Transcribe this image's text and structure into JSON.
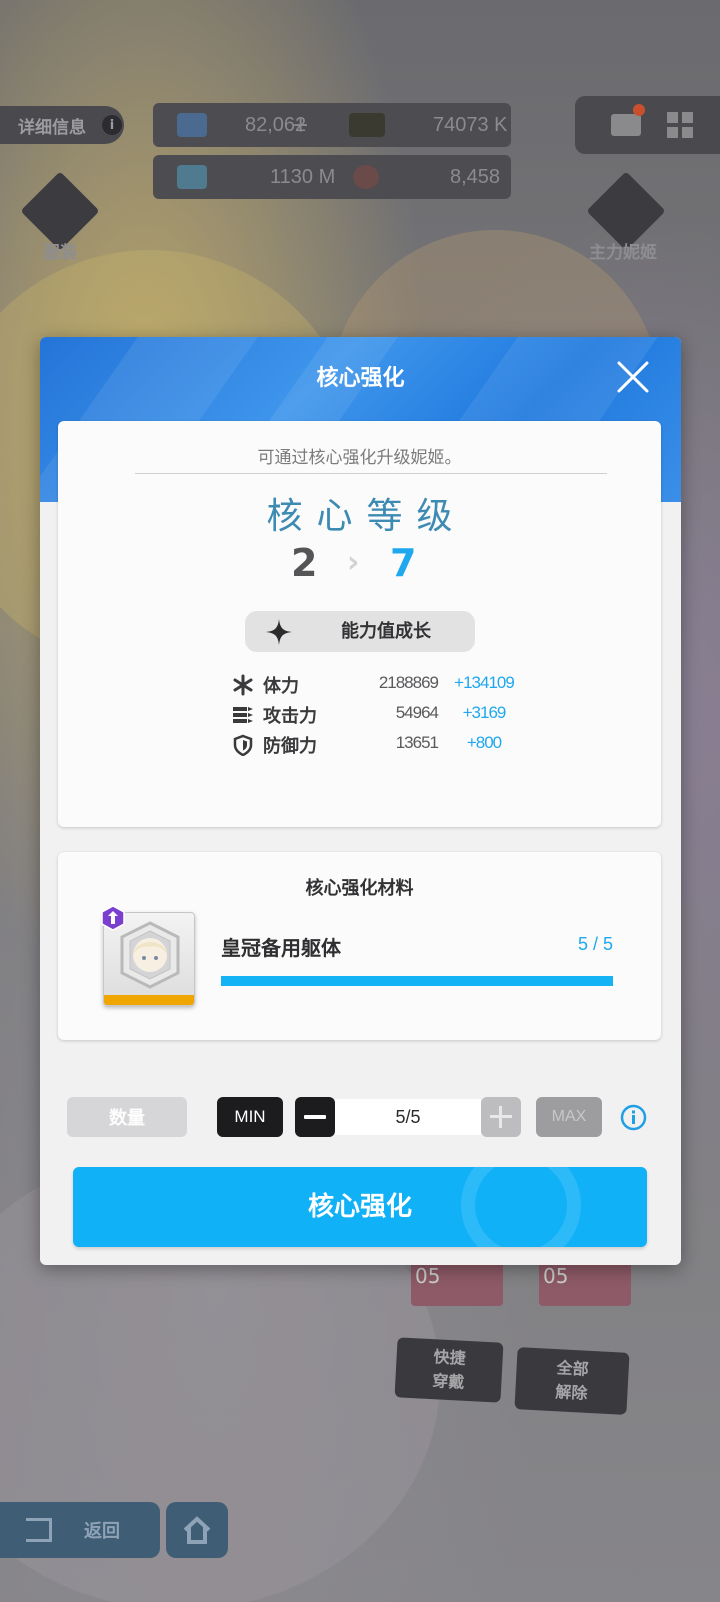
{
  "background": {
    "details_label": "详细信息",
    "resources": {
      "gems": "82,062",
      "credits": "74073 K",
      "battle_data": "1130 M",
      "core_dust": "8,458"
    },
    "outfit_label": "服装",
    "main_nikke_label": "主力妮姬",
    "quick_equip_label": "快捷\n穿戴",
    "remove_all_label": "全部\n解除",
    "back_label": "返回",
    "card_number_1": "05",
    "card_number_2": "05"
  },
  "modal": {
    "title": "核心强化",
    "hint": "可通过核心强化升级妮姬。",
    "level_title": "核心等级",
    "level_from": "2",
    "level_arrow": "›",
    "level_to": "7",
    "growth_label": "能力值成长",
    "stats": [
      {
        "name": "体力",
        "value": "2188869",
        "increase": "+134109",
        "icon": "asterisk-icon"
      },
      {
        "name": "攻击力",
        "value": "54964",
        "increase": "+3169",
        "icon": "bullets-icon"
      },
      {
        "name": "防御力",
        "value": "13651",
        "increase": "+800",
        "icon": "shield-icon"
      }
    ],
    "materials": {
      "title": "核心强化材料",
      "item_name": "皇冠备用躯体",
      "count": "5 / 5",
      "progress": 1.0
    },
    "quantity": {
      "label": "数量",
      "min_label": "MIN",
      "max_label": "MAX",
      "value": "5/5"
    },
    "action_label": "核心强化"
  },
  "colors": {
    "accent": "#20a8ee",
    "button": "#11b1f7",
    "header": "#2474d8",
    "progress": "#14b3f6",
    "rank_badge": "#7b3fd0"
  }
}
